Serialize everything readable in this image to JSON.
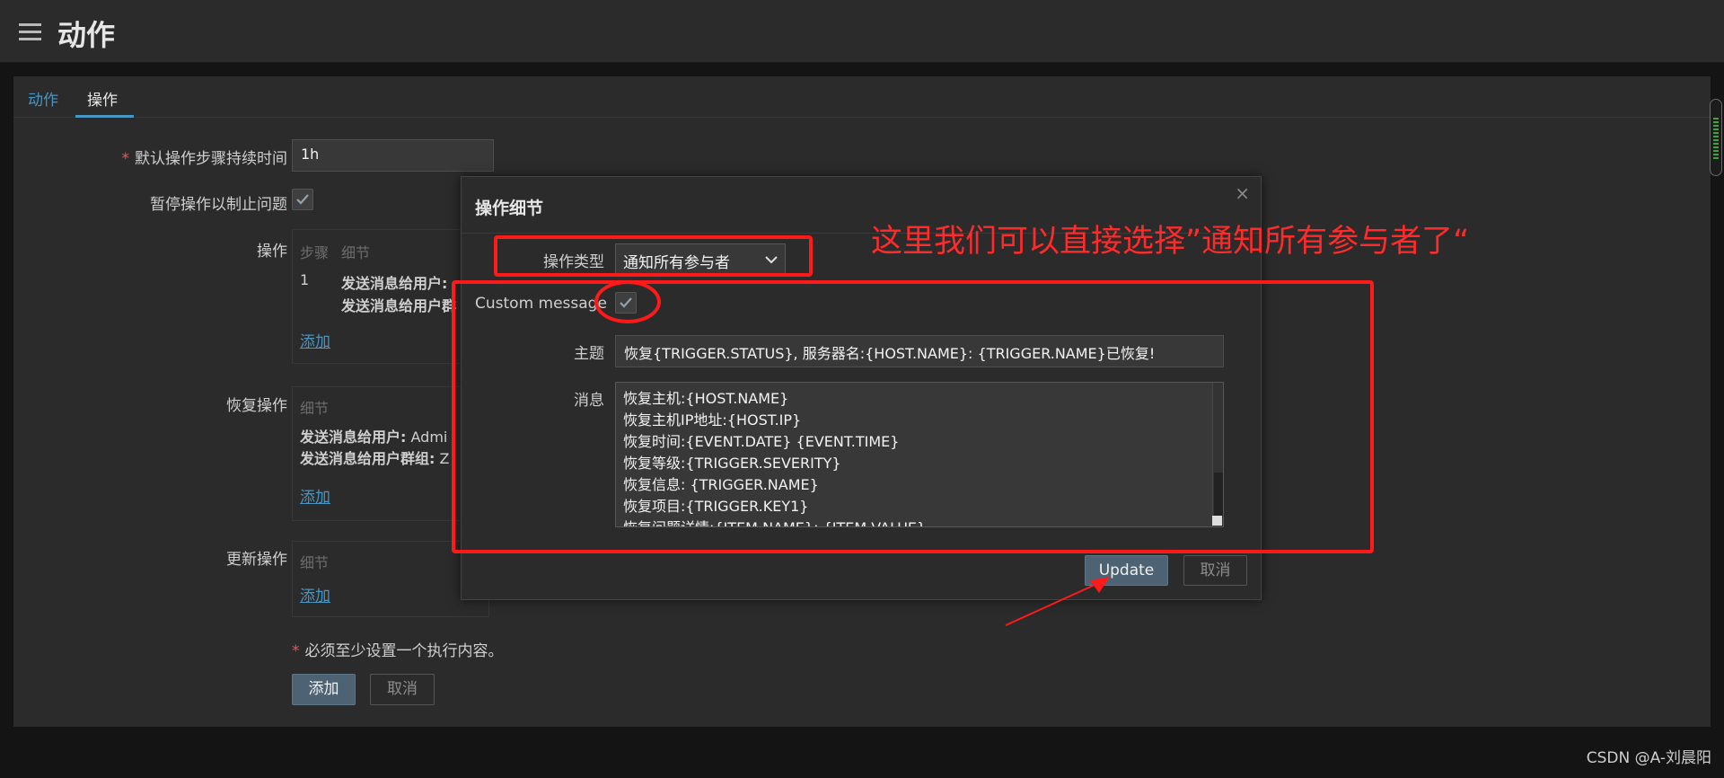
{
  "header": {
    "title": "动作",
    "menu_icon": "hamburger-menu-icon"
  },
  "tabs": [
    {
      "label": "动作",
      "active": false
    },
    {
      "label": "操作",
      "active": true
    }
  ],
  "form": {
    "default_duration": {
      "label": "默认操作步骤持续时间",
      "required": "*",
      "value": "1h"
    },
    "pause_label": "暂停操作以制止问题",
    "operations": {
      "label": "操作",
      "columns": [
        "步骤",
        "细节"
      ],
      "rows": [
        {
          "step": "1",
          "line1": "发送消息给用户:",
          "line2": "发送消息给用户群"
        }
      ],
      "add": "添加"
    },
    "recovery": {
      "label": "恢复操作",
      "column": "细节",
      "line1_bold": "发送消息给用户:",
      "line1_rest": " Admi",
      "line2_bold": "发送消息给用户群组:",
      "line2_rest": " Z",
      "add": "添加"
    },
    "update_ops": {
      "label": "更新操作",
      "column": "细节",
      "add": "添加"
    },
    "note_required": "*",
    "note": "必须至少设置一个执行内容。",
    "add_button": "添加",
    "cancel_button": "取消"
  },
  "modal": {
    "title": "操作细节",
    "close": "×",
    "op_type_label": "操作类型",
    "op_type_value": "通知所有参与者",
    "custom_message_label": "Custom message",
    "custom_message_checked": true,
    "subject_label": "主题",
    "subject_value": "恢复{TRIGGER.STATUS}, 服务器名:{HOST.NAME}: {TRIGGER.NAME}已恢复!",
    "message_label": "消息",
    "message_lines": [
      "恢复主机:{HOST.NAME}",
      "恢复主机IP地址:{HOST.IP}",
      "恢复时间:{EVENT.DATE} {EVENT.TIME}",
      "恢复等级:{TRIGGER.SEVERITY}",
      "恢复信息: {TRIGGER.NAME}",
      "恢复项目:{TRIGGER.KEY1}",
      "恢复问题详情:{ITEM.NAME}: {ITEM.VALUE}"
    ],
    "update_button": "Update",
    "cancel_button": "取消"
  },
  "annotation": {
    "text": "这里我们可以直接选择”通知所有参与者了“",
    "color": "#ff1a1a"
  },
  "watermark": "CSDN @A-刘晨阳",
  "colors": {
    "accent": "#4796c4",
    "required": "#e45959",
    "primary_button": "#4d6374"
  }
}
